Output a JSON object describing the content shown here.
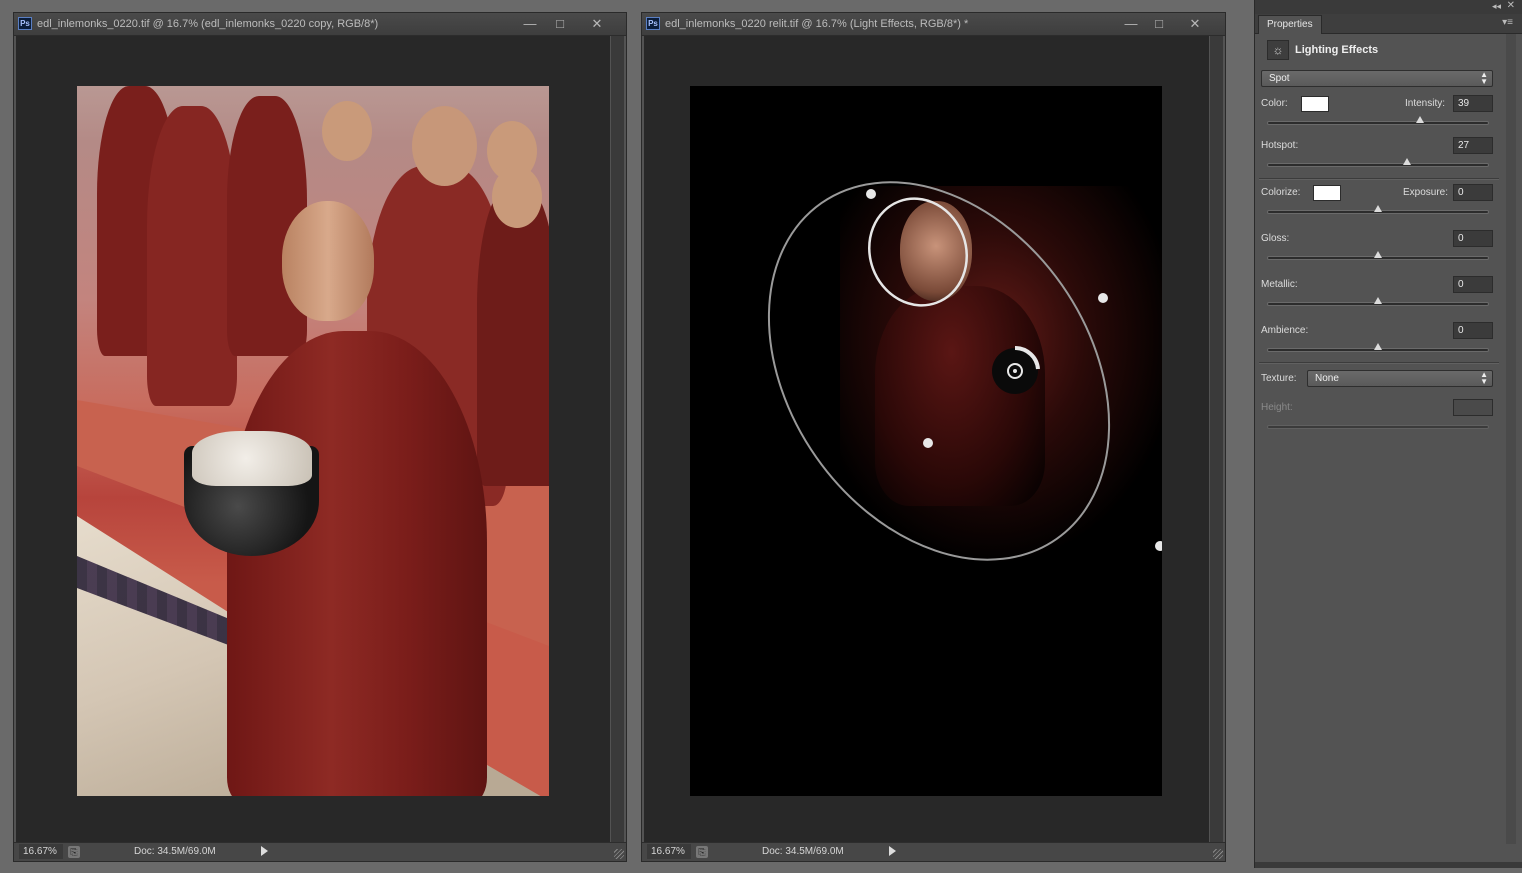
{
  "window1": {
    "title": "edl_inlemonks_0220.tif @ 16.7% (edl_inlemonks_0220 copy, RGB/8*)",
    "zoom": "16.67%",
    "doc_size": "Doc: 34.5M/69.0M"
  },
  "window2": {
    "title": "edl_inlemonks_0220 relit.tif @ 16.7% (Light Effects, RGB/8*) *",
    "zoom": "16.67%",
    "doc_size": "Doc: 34.5M/69.0M"
  },
  "window_buttons": {
    "minimize": "—",
    "maximize": "□",
    "close": "✕"
  },
  "properties": {
    "tab": "Properties",
    "panel_title": "Lighting Effects",
    "light_type": "Spot",
    "color_label": "Color:",
    "color_value": "#ffffff",
    "intensity_label": "Intensity:",
    "intensity": "39",
    "hotspot_label": "Hotspot:",
    "hotspot": "27",
    "colorize_label": "Colorize:",
    "colorize_value": "#ffffff",
    "exposure_label": "Exposure:",
    "exposure": "0",
    "gloss_label": "Gloss:",
    "gloss": "0",
    "metallic_label": "Metallic:",
    "metallic": "0",
    "ambience_label": "Ambience:",
    "ambience": "0",
    "texture_label": "Texture:",
    "texture": "None",
    "height_label": "Height:",
    "height": ""
  },
  "slider_levels": {
    "intensity": 0.69,
    "hotspot": 0.63,
    "exposure": 0.5,
    "gloss": 0.5,
    "metallic": 0.5,
    "ambience": 0.5
  },
  "icons": [
    "ps-icon",
    "lighting-effects-icon",
    "panel-menu-icon",
    "collapse-icon",
    "close-icon"
  ]
}
